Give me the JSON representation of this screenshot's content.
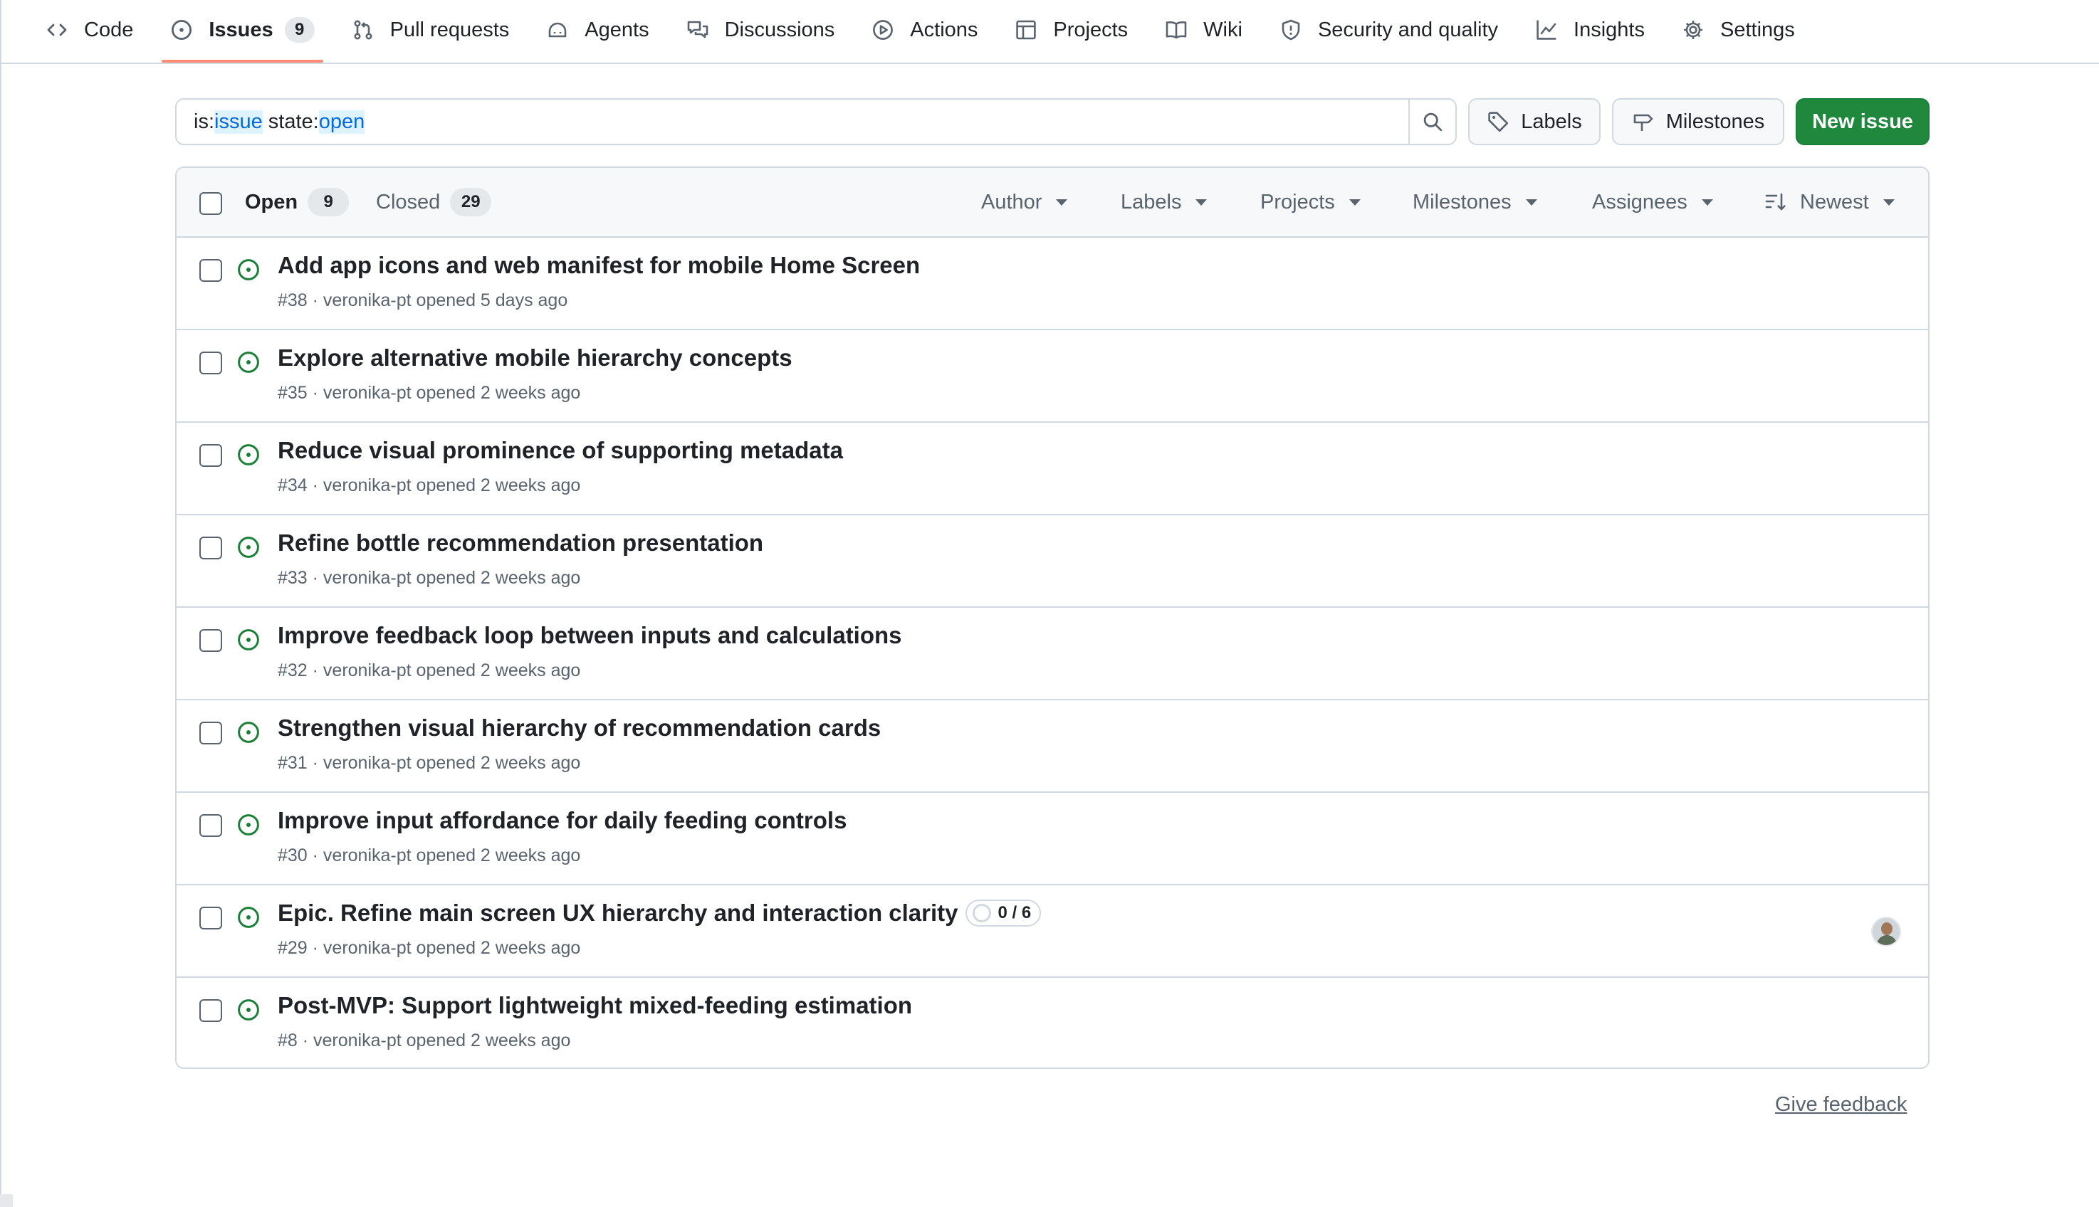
{
  "nav": {
    "items": [
      {
        "label": "Code",
        "icon": "code-icon"
      },
      {
        "label": "Issues",
        "icon": "issue-opened-icon",
        "count": "9",
        "selected": true
      },
      {
        "label": "Pull requests",
        "icon": "git-pull-request-icon"
      },
      {
        "label": "Agents",
        "icon": "agent-icon"
      },
      {
        "label": "Discussions",
        "icon": "comment-discussion-icon"
      },
      {
        "label": "Actions",
        "icon": "play-icon"
      },
      {
        "label": "Projects",
        "icon": "table-icon"
      },
      {
        "label": "Wiki",
        "icon": "book-icon"
      },
      {
        "label": "Security and quality",
        "icon": "shield-icon"
      },
      {
        "label": "Insights",
        "icon": "graph-icon"
      },
      {
        "label": "Settings",
        "icon": "gear-icon"
      }
    ]
  },
  "search": {
    "prefix1": "is:",
    "value1": "issue",
    "prefix2": " state:",
    "value2": "open",
    "button_icon": "search-icon"
  },
  "toolbar": {
    "labels": "Labels",
    "milestones": "Milestones",
    "new_issue": "New issue"
  },
  "header": {
    "open_label": "Open",
    "open_count": "9",
    "closed_label": "Closed",
    "closed_count": "29",
    "filters": {
      "author": "Author",
      "labels": "Labels",
      "projects": "Projects",
      "milestones": "Milestones",
      "assignees": "Assignees",
      "sort": "Newest"
    }
  },
  "issues": [
    {
      "title": "Add app icons and web manifest for mobile Home Screen",
      "meta": "#38 · veronika-pt opened 5 days ago"
    },
    {
      "title": "Explore alternative mobile hierarchy concepts",
      "meta": "#35 · veronika-pt opened 2 weeks ago"
    },
    {
      "title": "Reduce visual prominence of supporting metadata",
      "meta": "#34 · veronika-pt opened 2 weeks ago"
    },
    {
      "title": "Refine bottle recommendation presentation",
      "meta": "#33 · veronika-pt opened 2 weeks ago"
    },
    {
      "title": "Improve feedback loop between inputs and calculations",
      "meta": "#32 · veronika-pt opened 2 weeks ago"
    },
    {
      "title": "Strengthen visual hierarchy of recommendation cards",
      "meta": "#31 · veronika-pt opened 2 weeks ago"
    },
    {
      "title": "Improve input affordance for daily feeding controls",
      "meta": "#30 · veronika-pt opened 2 weeks ago"
    },
    {
      "title": "Epic. Refine main screen UX hierarchy and interaction clarity",
      "meta": "#29 · veronika-pt opened 2 weeks ago",
      "progress": "0 / 6"
    },
    {
      "title": "Post-MVP: Support lightweight mixed-feeding estimation",
      "meta": "#8 · veronika-pt opened 2 weeks ago"
    }
  ],
  "feedback": "Give feedback",
  "colors": {
    "accent": "#0969da",
    "open_issue": "#1a7f37",
    "primary_button": "#1f883d",
    "selected_tab_underline": "#fd8c73"
  }
}
